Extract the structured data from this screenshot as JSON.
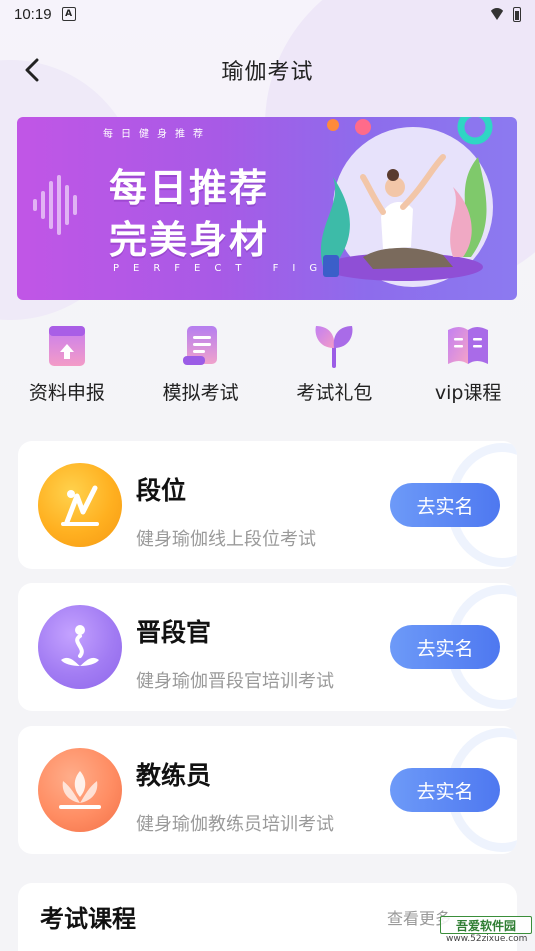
{
  "status_bar": {
    "time": "10:19",
    "notif_letter": "A"
  },
  "nav": {
    "title": "瑜伽考试"
  },
  "banner": {
    "small_top": "每日健身推荐",
    "line1": "每日推荐",
    "line2": "完美身材",
    "english": "PERFECT FIGURE"
  },
  "quick": [
    {
      "label": "资料申报",
      "icon": "document-upload-icon"
    },
    {
      "label": "模拟考试",
      "icon": "scroll-icon"
    },
    {
      "label": "考试礼包",
      "icon": "sprout-icon"
    },
    {
      "label": "vip课程",
      "icon": "book-icon"
    }
  ],
  "cards": [
    {
      "name": "段位",
      "desc": "健身瑜伽线上段位考试",
      "button": "去实名"
    },
    {
      "name": "晋段官",
      "desc": "健身瑜伽晋段官培训考试",
      "button": "去实名"
    },
    {
      "name": "教练员",
      "desc": "健身瑜伽教练员培训考试",
      "button": "去实名"
    }
  ],
  "course": {
    "heading": "考试课程",
    "more": "查看更多"
  },
  "watermark": {
    "label": "吾爱软件园",
    "url": "www.52zixue.com"
  },
  "colors": {
    "accent_blue": "#4e78f0",
    "banner_purple": "#a85ae6"
  }
}
